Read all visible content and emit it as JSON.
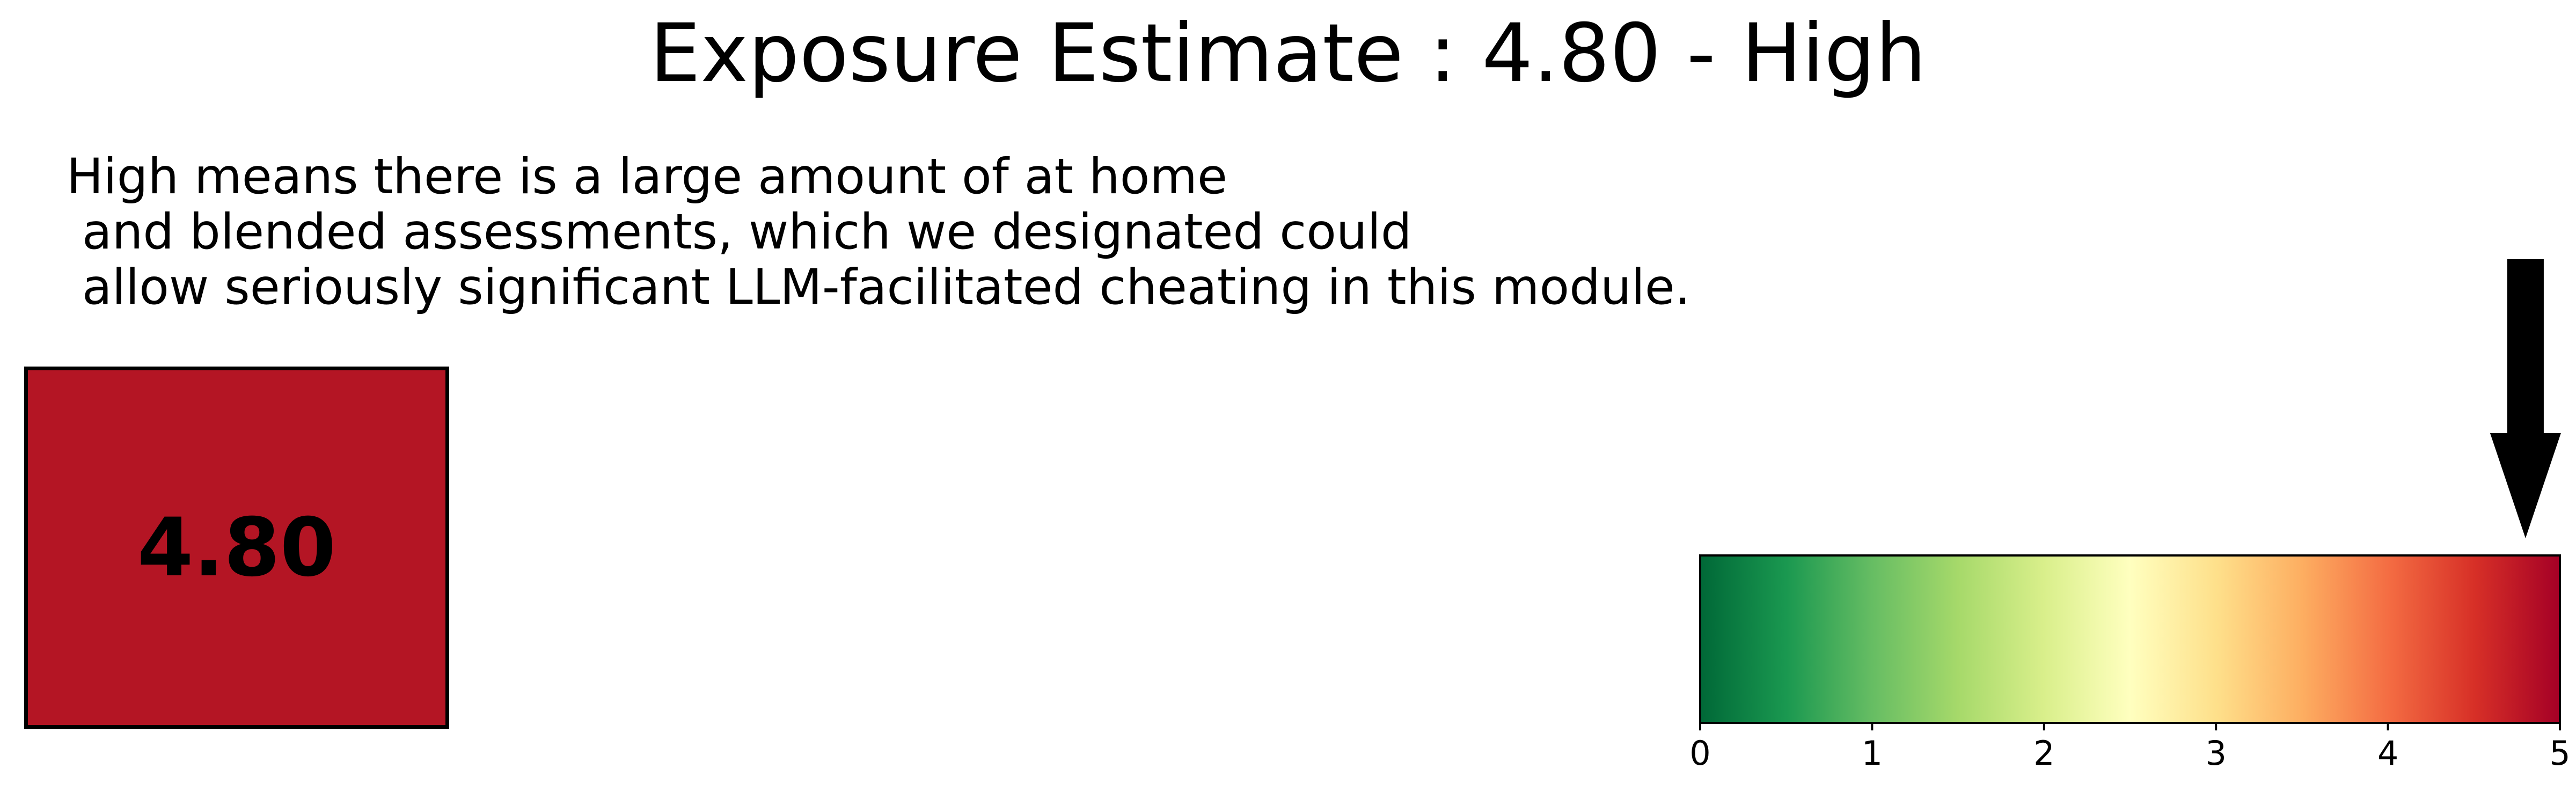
{
  "title": "Exposure Estimate : 4.80 - High",
  "description": "High means there is a large amount of at home\n and blended assessments, which we designated could\n allow seriously significant LLM-facilitated cheating in this module.",
  "score": {
    "label": "4.80",
    "fill_color": "#b41524"
  },
  "chart_data": {
    "type": "colorbar",
    "value": 4.8,
    "value_label": "4.80",
    "category": "High",
    "xlim": [
      0,
      5
    ],
    "ticks": [
      "0",
      "1",
      "2",
      "3",
      "4",
      "5"
    ],
    "tick_values": [
      0,
      1,
      2,
      3,
      4,
      5
    ],
    "colormap": "RdYlGn_r",
    "gradient_colors": [
      "#006837",
      "#1a9850",
      "#66bd63",
      "#a6d96a",
      "#d9ef8b",
      "#ffffbf",
      "#fee08b",
      "#fdae61",
      "#f46d43",
      "#d73027",
      "#a50026"
    ],
    "marker": "down-arrow",
    "marker_color": "#000000"
  }
}
